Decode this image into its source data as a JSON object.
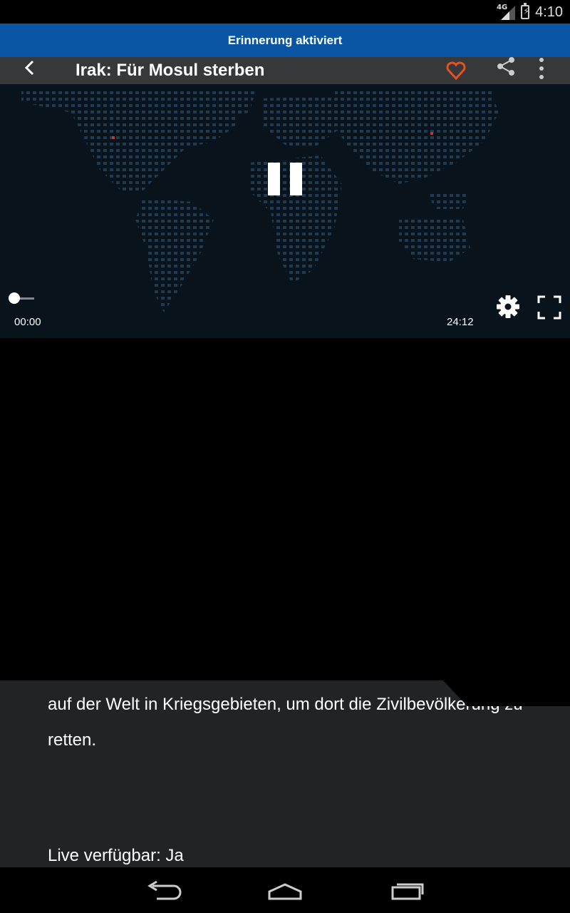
{
  "status_bar": {
    "network": "4G",
    "time": "4:10",
    "icons": [
      "signal-icon",
      "battery-charging-icon"
    ]
  },
  "toast": {
    "text": "Erinnerung aktiviert"
  },
  "action_bar": {
    "title": "Irak: Für Mosul sterben",
    "icons": [
      "back-arrow-icon",
      "heart-icon",
      "share-icon",
      "overflow-menu-icon"
    ],
    "accent_color": "#e8501e"
  },
  "player": {
    "state": "playing",
    "current_time": "00:00",
    "duration": "24:12",
    "progress": 0,
    "icons": [
      "pause-icon",
      "settings-gear-icon",
      "fullscreen-icon"
    ]
  },
  "description": {
    "line1": "auf der Welt in Kriegsgebieten, um dort die Zivilbevölkerung zu",
    "line2": "retten.",
    "live_available": "Live verfügbar: Ja"
  },
  "nav_bar": {
    "icons": [
      "nav-back-icon",
      "nav-home-icon",
      "nav-recents-icon"
    ]
  },
  "colors": {
    "toast_bg": "#0a56a5",
    "player_bg": "#08131c",
    "content_bg": "#222324"
  }
}
